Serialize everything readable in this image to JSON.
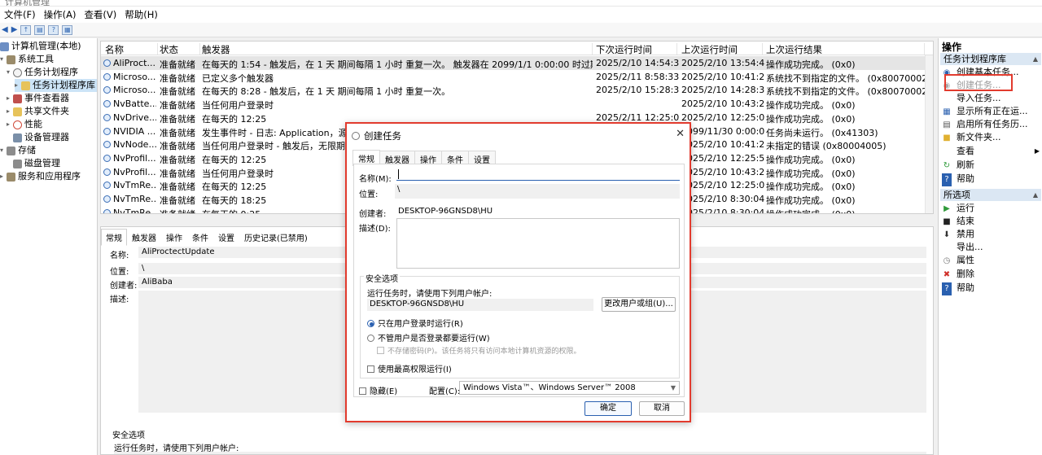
{
  "window": {
    "title": "计算机管理"
  },
  "menu": [
    "文件(F)",
    "操作(A)",
    "查看(V)",
    "帮助(H)"
  ],
  "tree": [
    "计算机管理(本地)",
    "系统工具",
    "任务计划程序",
    "任务计划程序库",
    "事件查看器",
    "共享文件夹",
    "性能",
    "设备管理器",
    "存储",
    "磁盘管理",
    "服务和应用程序"
  ],
  "task_list": {
    "columns": [
      "名称",
      "状态",
      "触发器",
      "下次运行时间",
      "上次运行时间",
      "上次运行结果"
    ],
    "rows": [
      [
        "AliProct...",
        "准备就绪",
        "在每天的 1:54 - 触发后，在 1 天 期间每隔 1 小时 重复一次。 触发器在 2099/1/1 0:00:00 时过期。",
        "2025/2/10 14:54:39",
        "2025/2/10 13:54:40",
        "操作成功完成。 (0x0)"
      ],
      [
        "Microso...",
        "准备就绪",
        "已定义多个触发器",
        "2025/2/11 8:58:33",
        "2025/2/10 10:41:29",
        "系统找不到指定的文件。 (0x80070002)"
      ],
      [
        "Microso...",
        "准备就绪",
        "在每天的 8:28 - 触发后，在 1 天 期间每隔 1 小时 重复一次。",
        "2025/2/10 15:28:33",
        "2025/2/10 14:28:34",
        "系统找不到指定的文件。 (0x80070002)"
      ],
      [
        "NvBatte...",
        "准备就绪",
        "当任何用户登录时",
        "",
        "2025/2/10 10:43:29",
        "操作成功完成。 (0x0)"
      ],
      [
        "NvDrive...",
        "准备就绪",
        "在每天的 12:25",
        "2025/2/11 12:25:01",
        "2025/2/10 12:25:02",
        "操作成功完成。 (0x0)"
      ],
      [
        "NVIDIA ...",
        "准备就绪",
        "发生事件时 - 日志: Application，源:",
        "",
        "2099/11/30 0:00:00",
        "任务尚未运行。 (0x41303)"
      ],
      [
        "NvNode...",
        "准备就绪",
        "当任何用户登录时 - 触发后，无限期地",
        "",
        "2025/2/10 10:41:29",
        "未指定的错误 (0x80004005)"
      ],
      [
        "NvProfil...",
        "准备就绪",
        "在每天的 12:25",
        "",
        "2025/2/10 12:25:52",
        "操作成功完成。 (0x0)"
      ],
      [
        "NvProfil...",
        "准备就绪",
        "当任何用户登录时",
        "",
        "2025/2/10 10:43:29",
        "操作成功完成。 (0x0)"
      ],
      [
        "NvTmRe...",
        "准备就绪",
        "在每天的 12:25",
        "",
        "2025/2/10 12:25:02",
        "操作成功完成。 (0x0)"
      ],
      [
        "NvTmRe...",
        "准备就绪",
        "在每天的 18:25",
        "",
        "2025/2/10 8:30:04",
        "操作成功完成。 (0x0)"
      ],
      [
        "NvTmRe...",
        "准备就绪",
        "在每天的 0:25",
        "",
        "2025/2/10 8:30:04",
        "操作成功完成。 (0x0)"
      ]
    ]
  },
  "detail": {
    "tabs": [
      "常规",
      "触发器",
      "操作",
      "条件",
      "设置",
      "历史记录(已禁用)"
    ],
    "name_label": "名称:",
    "name_value": "AliProctectUpdate",
    "location_label": "位置:",
    "location_value": "\\",
    "author_label": "创建者:",
    "author_value": "AliBaba",
    "desc_label": "描述:",
    "security_title": "安全选项",
    "security_run_as": "运行任务时，请使用下列用户帐户:"
  },
  "actions": {
    "header": "操作",
    "section1": "任务计划程序库",
    "items1": [
      "创建基本任务...",
      "创建任务...",
      "导入任务...",
      "显示所有正在运...",
      "启用所有任务历...",
      "新文件夹...",
      "查看",
      "刷新",
      "帮助"
    ],
    "section2": "所选项",
    "items2": [
      "运行",
      "结束",
      "禁用",
      "导出...",
      "属性",
      "删除",
      "帮助"
    ]
  },
  "dialog": {
    "title": "创建任务",
    "tabs": [
      "常规",
      "触发器",
      "操作",
      "条件",
      "设置"
    ],
    "name_label": "名称(M):",
    "location_label": "位置:",
    "location_value": "\\",
    "author_label": "创建者:",
    "author_value": "DESKTOP-96GNSD8\\HU",
    "desc_label": "描述(D):",
    "security_title": "安全选项",
    "run_as_label": "运行任务时，请使用下列用户帐户:",
    "run_as_value": "DESKTOP-96GNSD8\\HU",
    "change_user_button": "更改用户或组(U)...",
    "radio_logged_on": "只在用户登录时运行(R)",
    "radio_any": "不管用户是否登录都要运行(W)",
    "no_store_password": "不存储密码(P)。该任务将只有访问本地计算机资源的权限。",
    "highest_priv": "使用最高权限运行(I)",
    "hidden": "隐藏(E)",
    "configure_label": "配置(C):",
    "configure_value": "Windows Vista™、Windows Server™ 2008",
    "ok": "确定",
    "cancel": "取消"
  },
  "colors": {
    "highlight": "#e23b2e",
    "accent": "#2a60b0",
    "selection": "#cce4f7"
  }
}
